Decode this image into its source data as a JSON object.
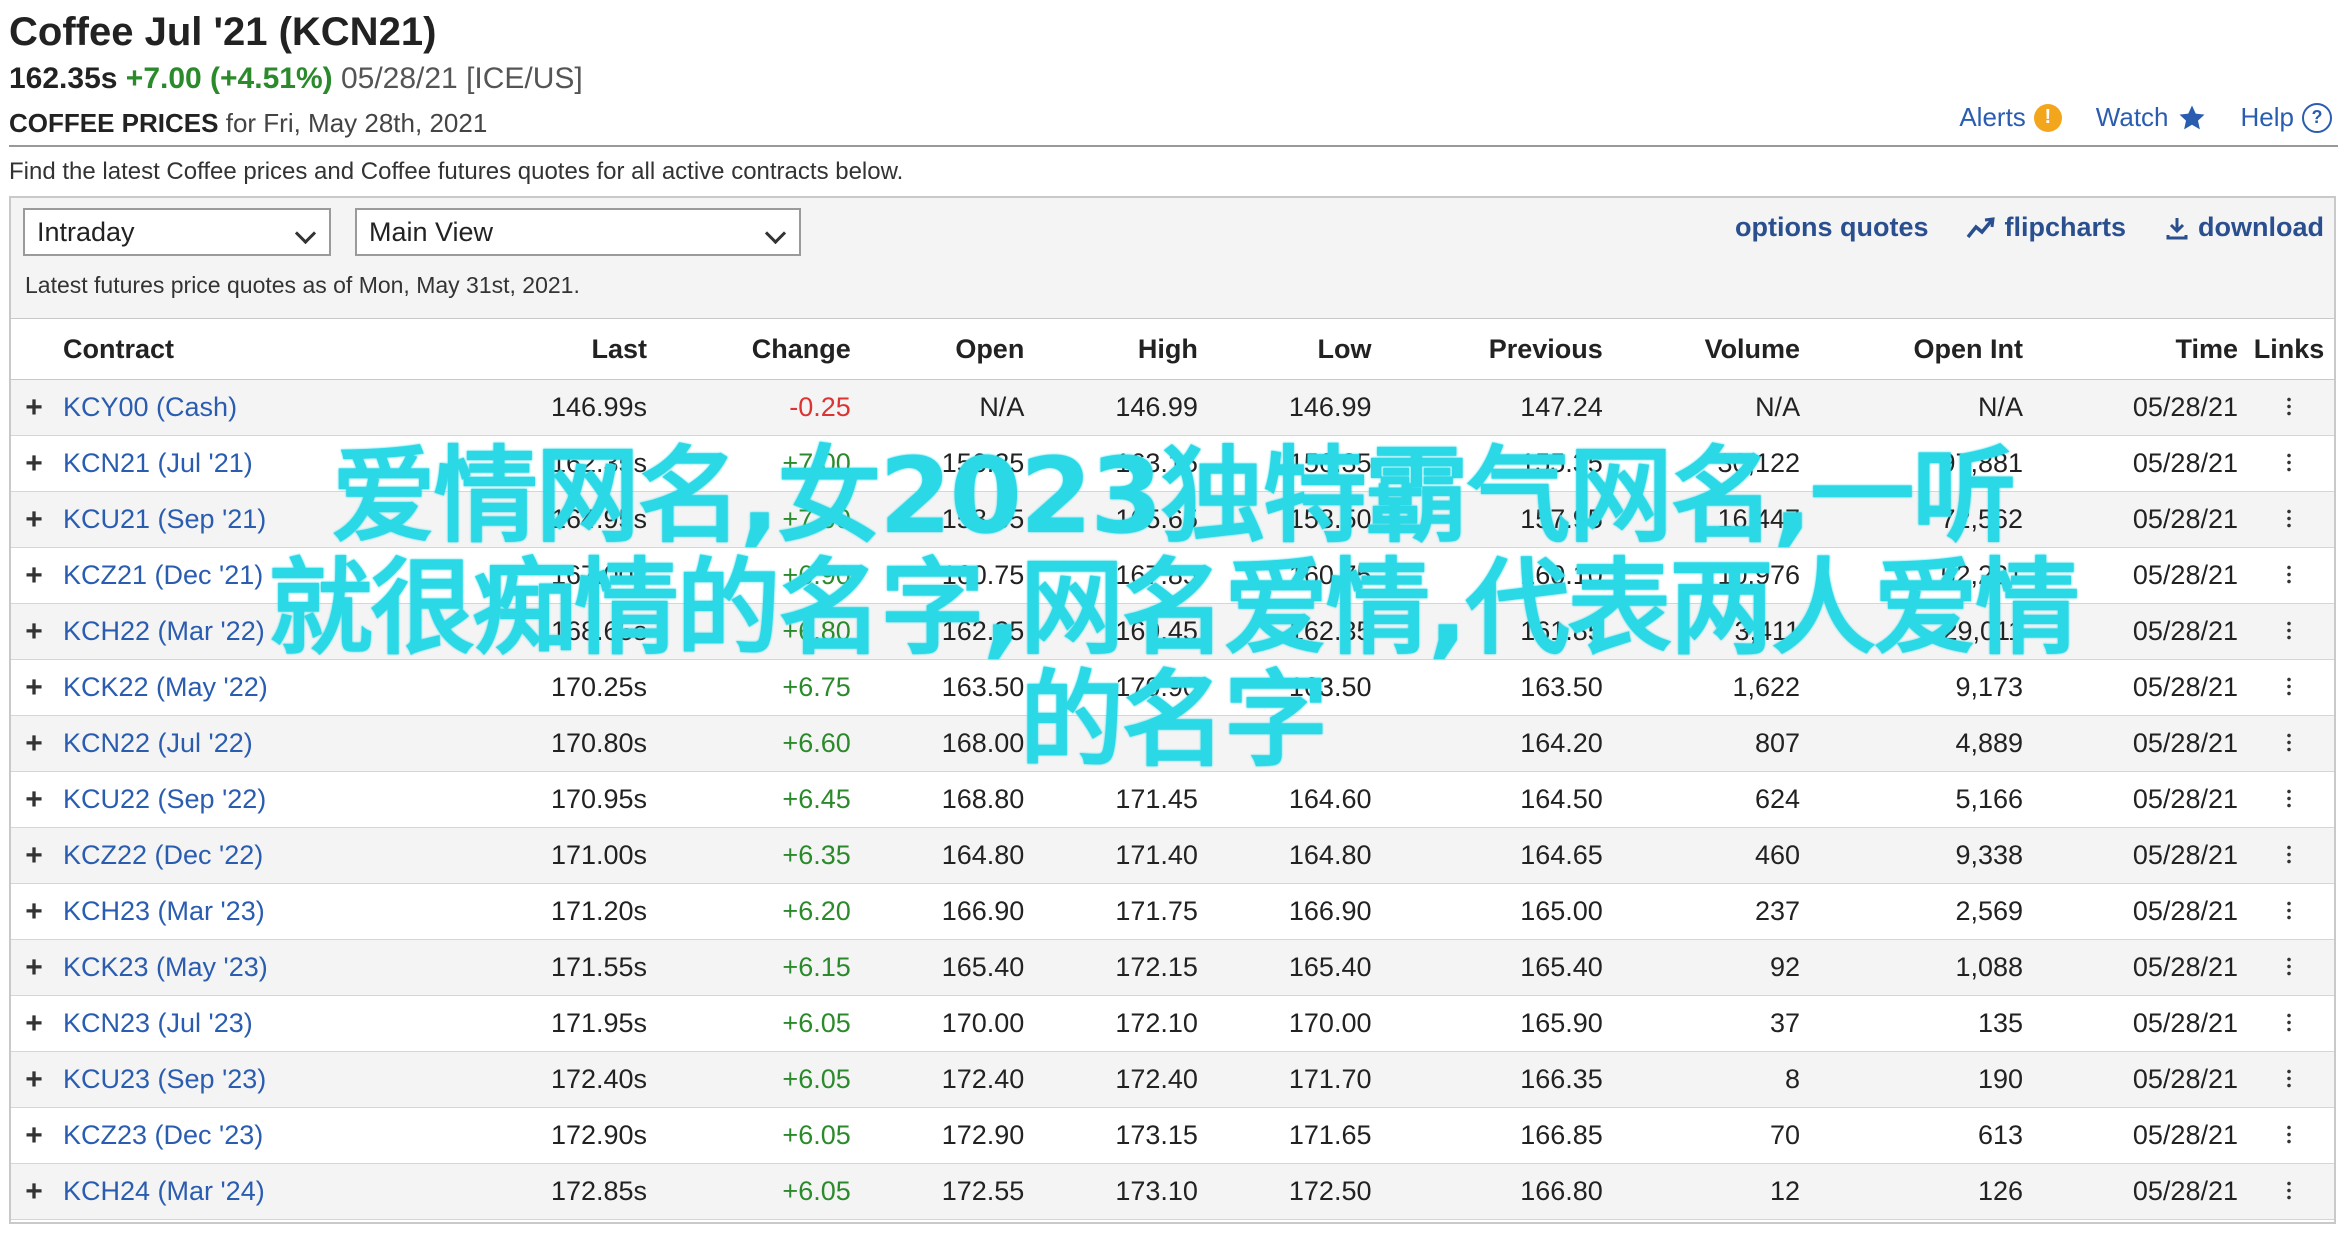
{
  "header": {
    "title": "Coffee Jul '21 (KCN21)",
    "price": "162.35s",
    "change": "+7.00 (+4.51%)",
    "date": "05/28/21",
    "exchange": "[ICE/US]",
    "prices_label": "COFFEE PRICES",
    "prices_for": "for Fri, May 28th, 2021"
  },
  "top_links": {
    "alerts": "Alerts",
    "watch": "Watch",
    "help": "Help"
  },
  "intro": "Find the latest Coffee prices and Coffee futures quotes for all active contracts below.",
  "toolbar": {
    "interval": "Intraday",
    "view": "Main View",
    "options_quotes": "options quotes",
    "flipcharts": "flipcharts",
    "download": "download",
    "as_of": "Latest futures price quotes as of Mon, May 31st, 2021."
  },
  "table": {
    "headers": [
      "Contract",
      "Last",
      "Change",
      "Open",
      "High",
      "Low",
      "Previous",
      "Volume",
      "Open Int",
      "Time",
      "Links"
    ],
    "rows": [
      [
        "KCY00 (Cash)",
        "146.99s",
        "-0.25",
        "N/A",
        "146.99",
        "146.99",
        "147.24",
        "N/A",
        "N/A",
        "05/28/21"
      ],
      [
        "KCN21 (Jul '21)",
        "162.35s",
        "+7.00",
        "156.35",
        "163.15",
        "156.35",
        "155.35",
        "30,122",
        "97,881",
        "05/28/21"
      ],
      [
        "KCU21 (Sep '21)",
        "164.95s",
        "+7.00",
        "158.65",
        "165.65",
        "158.50",
        "157.95",
        "16,447",
        "72,562",
        "05/28/21"
      ],
      [
        "KCZ21 (Dec '21)",
        "167.00s",
        "+6.90",
        "160.75",
        "167.85",
        "160.75",
        "160.10",
        "10,976",
        "52,231",
        "05/28/21"
      ],
      [
        "KCH22 (Mar '22)",
        "168.65s",
        "+6.80",
        "162.35",
        "169.45",
        "162.35",
        "161.85",
        "3,411",
        "29,011",
        "05/28/21"
      ],
      [
        "KCK22 (May '22)",
        "170.25s",
        "+6.75",
        "163.50",
        "170.90",
        "163.50",
        "163.50",
        "1,622",
        "9,173",
        "05/28/21"
      ],
      [
        "KCN22 (Jul '22)",
        "170.80s",
        "+6.60",
        "168.00",
        "",
        "",
        "164.20",
        "807",
        "4,889",
        "05/28/21"
      ],
      [
        "KCU22 (Sep '22)",
        "170.95s",
        "+6.45",
        "168.80",
        "171.45",
        "164.60",
        "164.50",
        "624",
        "5,166",
        "05/28/21"
      ],
      [
        "KCZ22 (Dec '22)",
        "171.00s",
        "+6.35",
        "164.80",
        "171.40",
        "164.80",
        "164.65",
        "460",
        "9,338",
        "05/28/21"
      ],
      [
        "KCH23 (Mar '23)",
        "171.20s",
        "+6.20",
        "166.90",
        "171.75",
        "166.90",
        "165.00",
        "237",
        "2,569",
        "05/28/21"
      ],
      [
        "KCK23 (May '23)",
        "171.55s",
        "+6.15",
        "165.40",
        "172.15",
        "165.40",
        "165.40",
        "92",
        "1,088",
        "05/28/21"
      ],
      [
        "KCN23 (Jul '23)",
        "171.95s",
        "+6.05",
        "170.00",
        "172.10",
        "170.00",
        "165.90",
        "37",
        "135",
        "05/28/21"
      ],
      [
        "KCU23 (Sep '23)",
        "172.40s",
        "+6.05",
        "172.40",
        "172.40",
        "171.70",
        "166.35",
        "8",
        "190",
        "05/28/21"
      ],
      [
        "KCZ23 (Dec '23)",
        "172.90s",
        "+6.05",
        "172.90",
        "173.15",
        "171.65",
        "166.85",
        "70",
        "613",
        "05/28/21"
      ],
      [
        "KCH24 (Mar '24)",
        "172.85s",
        "+6.05",
        "172.55",
        "173.10",
        "172.50",
        "166.80",
        "12",
        "126",
        "05/28/21"
      ]
    ]
  },
  "overlay": {
    "line1": "爱情网名,女2023独特霸气网名,一听",
    "line2": "就很痴情的名字,网名爱情,代表两人爱情",
    "line3": "的名字"
  },
  "colors": {
    "link_blue": "#2a5db0",
    "up_green": "#2b8a2b",
    "down_red": "#d33333",
    "overlay_cyan": "#2ad8e6",
    "alert_orange": "#f3a51c"
  }
}
